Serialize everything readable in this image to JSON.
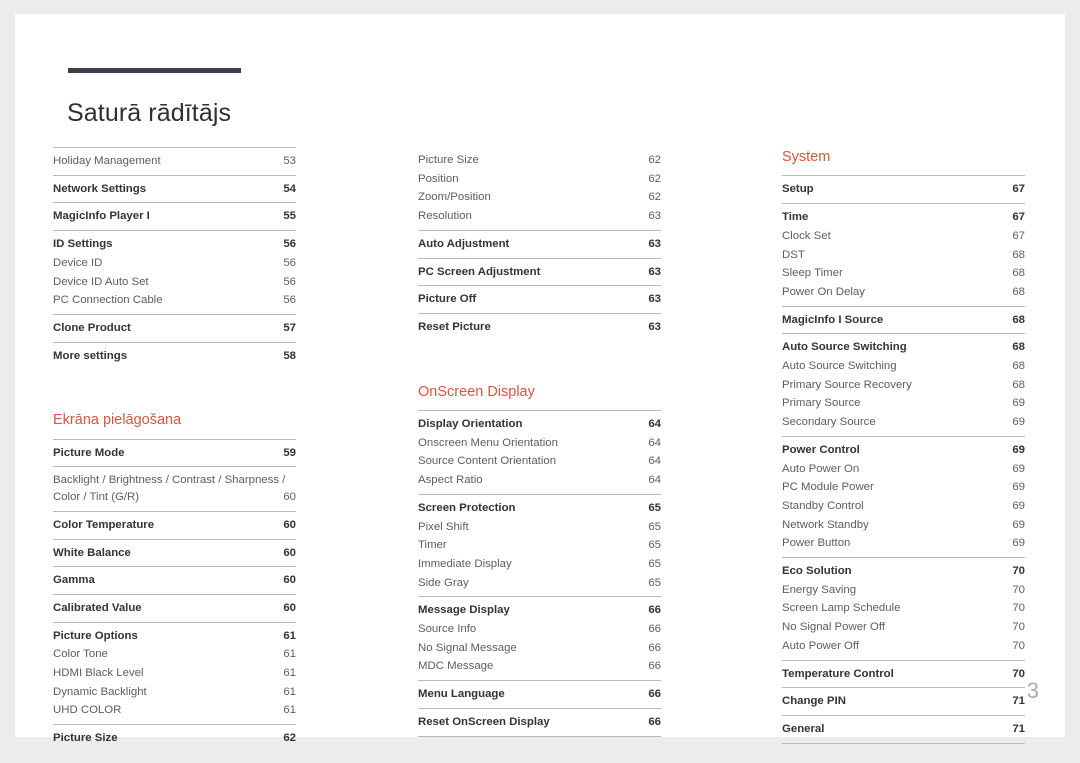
{
  "document": {
    "title": "Saturā rādītājs",
    "page_number": "3",
    "accent_color": "#d9573a",
    "rule_color": "#403e4c"
  },
  "columns": [
    {
      "name": "column-1",
      "blocks": [
        {
          "type": "group",
          "entries": [
            {
              "label": "Holiday Management",
              "page": "53",
              "level": "sub"
            }
          ]
        },
        {
          "type": "group",
          "entries": [
            {
              "label": "Network Settings",
              "page": "54",
              "level": "main"
            }
          ]
        },
        {
          "type": "group",
          "entries": [
            {
              "label": "MagicInfo Player I",
              "page": "55",
              "level": "main"
            }
          ]
        },
        {
          "type": "group",
          "entries": [
            {
              "label": "ID Settings",
              "page": "56",
              "level": "main"
            },
            {
              "label": "Device ID",
              "page": "56",
              "level": "sub"
            },
            {
              "label": "Device ID Auto Set",
              "page": "56",
              "level": "sub"
            },
            {
              "label": "PC Connection Cable",
              "page": "56",
              "level": "sub"
            }
          ]
        },
        {
          "type": "group",
          "entries": [
            {
              "label": "Clone Product",
              "page": "57",
              "level": "main"
            }
          ]
        },
        {
          "type": "group",
          "entries": [
            {
              "label": "More settings",
              "page": "58",
              "level": "main"
            }
          ]
        },
        {
          "type": "spacer"
        },
        {
          "type": "section",
          "label": "Ekrāna pielāgošana"
        },
        {
          "type": "group",
          "entries": [
            {
              "label": "Picture Mode",
              "page": "59",
              "level": "main"
            }
          ]
        },
        {
          "type": "group",
          "entries": [
            {
              "label": "Backlight / Brightness / Contrast / Sharpness / Color / Tint (G/R)",
              "page": "60",
              "level": "wrap"
            }
          ]
        },
        {
          "type": "group",
          "entries": [
            {
              "label": "Color Temperature",
              "page": "60",
              "level": "main"
            }
          ]
        },
        {
          "type": "group",
          "entries": [
            {
              "label": "White Balance",
              "page": "60",
              "level": "main"
            }
          ]
        },
        {
          "type": "group",
          "entries": [
            {
              "label": "Gamma",
              "page": "60",
              "level": "main"
            }
          ]
        },
        {
          "type": "group",
          "entries": [
            {
              "label": "Calibrated Value",
              "page": "60",
              "level": "main"
            }
          ]
        },
        {
          "type": "group",
          "entries": [
            {
              "label": "Picture Options",
              "page": "61",
              "level": "main"
            },
            {
              "label": "Color Tone",
              "page": "61",
              "level": "sub"
            },
            {
              "label": "HDMI Black Level",
              "page": "61",
              "level": "sub"
            },
            {
              "label": "Dynamic Backlight",
              "page": "61",
              "level": "sub"
            },
            {
              "label": "UHD COLOR",
              "page": "61",
              "level": "sub"
            }
          ]
        },
        {
          "type": "group",
          "entries": [
            {
              "label": "Picture Size",
              "page": "62",
              "level": "main"
            }
          ]
        }
      ]
    },
    {
      "name": "column-2",
      "blocks": [
        {
          "type": "group-norule",
          "entries": [
            {
              "label": "Picture Size",
              "page": "62",
              "level": "sub"
            },
            {
              "label": "Position",
              "page": "62",
              "level": "sub"
            },
            {
              "label": "Zoom/Position",
              "page": "62",
              "level": "sub"
            },
            {
              "label": "Resolution",
              "page": "63",
              "level": "sub"
            }
          ]
        },
        {
          "type": "group",
          "entries": [
            {
              "label": "Auto Adjustment",
              "page": "63",
              "level": "main"
            }
          ]
        },
        {
          "type": "group",
          "entries": [
            {
              "label": "PC Screen Adjustment",
              "page": "63",
              "level": "main"
            }
          ]
        },
        {
          "type": "group",
          "entries": [
            {
              "label": "Picture Off",
              "page": "63",
              "level": "main"
            }
          ]
        },
        {
          "type": "group",
          "entries": [
            {
              "label": "Reset Picture",
              "page": "63",
              "level": "main"
            }
          ]
        },
        {
          "type": "spacer"
        },
        {
          "type": "section",
          "label": "OnScreen Display"
        },
        {
          "type": "group",
          "entries": [
            {
              "label": "Display Orientation",
              "page": "64",
              "level": "main"
            },
            {
              "label": "Onscreen Menu Orientation",
              "page": "64",
              "level": "sub"
            },
            {
              "label": "Source Content Orientation",
              "page": "64",
              "level": "sub"
            },
            {
              "label": "Aspect Ratio",
              "page": "64",
              "level": "sub"
            }
          ]
        },
        {
          "type": "group",
          "entries": [
            {
              "label": "Screen Protection",
              "page": "65",
              "level": "main"
            },
            {
              "label": "Pixel Shift",
              "page": "65",
              "level": "sub"
            },
            {
              "label": "Timer",
              "page": "65",
              "level": "sub"
            },
            {
              "label": "Immediate Display",
              "page": "65",
              "level": "sub"
            },
            {
              "label": "Side Gray",
              "page": "65",
              "level": "sub"
            }
          ]
        },
        {
          "type": "group",
          "entries": [
            {
              "label": "Message Display",
              "page": "66",
              "level": "main"
            },
            {
              "label": "Source Info",
              "page": "66",
              "level": "sub"
            },
            {
              "label": "No Signal Message",
              "page": "66",
              "level": "sub"
            },
            {
              "label": "MDC Message",
              "page": "66",
              "level": "sub"
            }
          ]
        },
        {
          "type": "group",
          "entries": [
            {
              "label": "Menu Language",
              "page": "66",
              "level": "main"
            }
          ]
        },
        {
          "type": "group-both",
          "entries": [
            {
              "label": "Reset OnScreen Display",
              "page": "66",
              "level": "main"
            }
          ]
        }
      ]
    },
    {
      "name": "column-3",
      "blocks": [
        {
          "type": "section",
          "label": "System"
        },
        {
          "type": "group",
          "entries": [
            {
              "label": "Setup",
              "page": "67",
              "level": "main"
            }
          ]
        },
        {
          "type": "group",
          "entries": [
            {
              "label": "Time",
              "page": "67",
              "level": "main"
            },
            {
              "label": "Clock Set",
              "page": "67",
              "level": "sub"
            },
            {
              "label": "DST",
              "page": "68",
              "level": "sub"
            },
            {
              "label": "Sleep Timer",
              "page": "68",
              "level": "sub"
            },
            {
              "label": "Power On Delay",
              "page": "68",
              "level": "sub"
            }
          ]
        },
        {
          "type": "group",
          "entries": [
            {
              "label": "MagicInfo I Source",
              "page": "68",
              "level": "main"
            }
          ]
        },
        {
          "type": "group",
          "entries": [
            {
              "label": "Auto Source Switching",
              "page": "68",
              "level": "main"
            },
            {
              "label": "Auto Source Switching",
              "page": "68",
              "level": "sub"
            },
            {
              "label": "Primary Source Recovery",
              "page": "68",
              "level": "sub"
            },
            {
              "label": "Primary Source",
              "page": "69",
              "level": "sub"
            },
            {
              "label": "Secondary Source",
              "page": "69",
              "level": "sub"
            }
          ]
        },
        {
          "type": "group",
          "entries": [
            {
              "label": "Power Control",
              "page": "69",
              "level": "main"
            },
            {
              "label": "Auto Power On",
              "page": "69",
              "level": "sub"
            },
            {
              "label": "PC Module Power",
              "page": "69",
              "level": "sub"
            },
            {
              "label": "Standby Control",
              "page": "69",
              "level": "sub"
            },
            {
              "label": "Network Standby",
              "page": "69",
              "level": "sub"
            },
            {
              "label": "Power Button",
              "page": "69",
              "level": "sub"
            }
          ]
        },
        {
          "type": "group",
          "entries": [
            {
              "label": "Eco Solution",
              "page": "70",
              "level": "main"
            },
            {
              "label": "Energy Saving",
              "page": "70",
              "level": "sub"
            },
            {
              "label": "Screen Lamp Schedule",
              "page": "70",
              "level": "sub"
            },
            {
              "label": "No Signal Power Off",
              "page": "70",
              "level": "sub"
            },
            {
              "label": "Auto Power Off",
              "page": "70",
              "level": "sub"
            }
          ]
        },
        {
          "type": "group",
          "entries": [
            {
              "label": "Temperature Control",
              "page": "70",
              "level": "main"
            }
          ]
        },
        {
          "type": "group",
          "entries": [
            {
              "label": "Change PIN",
              "page": "71",
              "level": "main"
            }
          ]
        },
        {
          "type": "group-both",
          "entries": [
            {
              "label": "General",
              "page": "71",
              "level": "main"
            }
          ]
        }
      ]
    }
  ]
}
